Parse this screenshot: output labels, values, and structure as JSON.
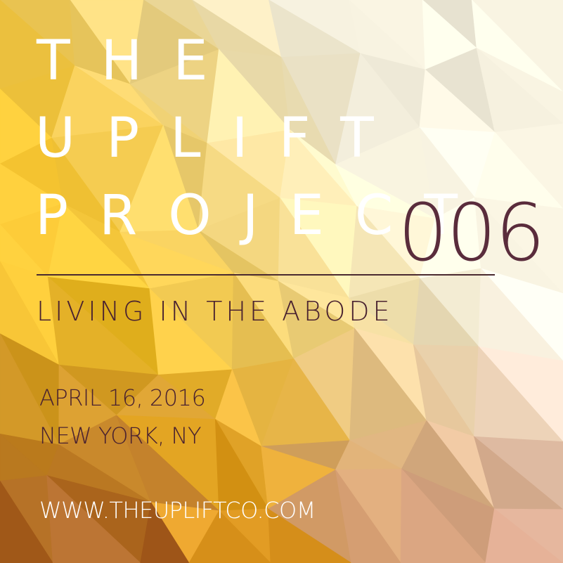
{
  "poster": {
    "title_lines": [
      "THE",
      "UPLIFT",
      "PROJECT"
    ],
    "edition_number": "006",
    "subtitle": "LIVING IN THE ABODE",
    "date": "APRIL 16, 2016",
    "location": "NEW YORK, NY",
    "website": "WWW.THEUPLIFTCO.COM"
  },
  "colors": {
    "title_text": "#ffffff",
    "dark_text": "#4a2230",
    "edition_text": "#5a2c3c",
    "background_light": "#fbf6e4",
    "background_yellow": "#f2c12e",
    "background_orange": "#d98a1e",
    "background_brown": "#9a4a2a",
    "background_rose": "#c88a7a"
  }
}
